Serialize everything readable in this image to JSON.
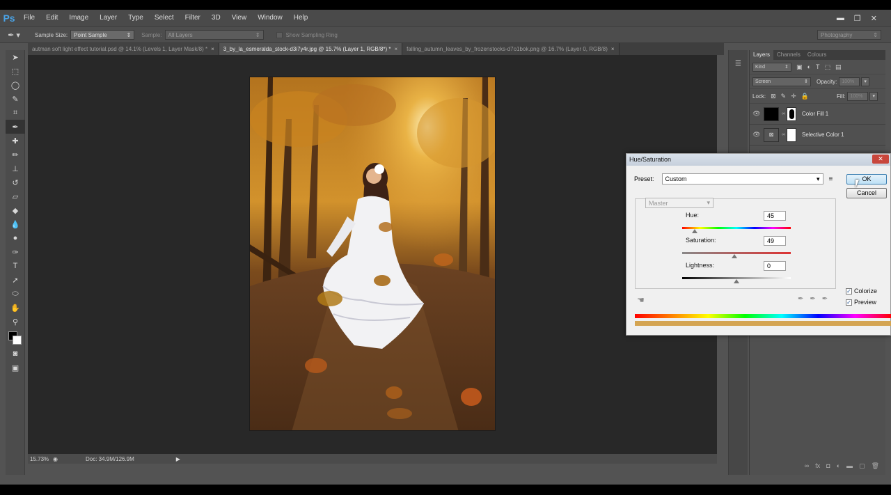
{
  "app": {
    "logo": "Ps"
  },
  "menu": [
    "File",
    "Edit",
    "Image",
    "Layer",
    "Type",
    "Select",
    "Filter",
    "3D",
    "View",
    "Window",
    "Help"
  ],
  "options_bar": {
    "sample_size_label": "Sample Size:",
    "sample_size_value": "Point Sample",
    "sample_label": "Sample:",
    "sample_value": "All Layers",
    "show_ring_label": "Show Sampling Ring",
    "workspace": "Photography"
  },
  "tabs": [
    {
      "label": "autman soft light effect tutorial.psd @ 14.1% (Levels 1, Layer Mask/8) *",
      "active": false
    },
    {
      "label": "3_by_la_esmeralda_stock-d3i7y4r.jpg @ 15.7% (Layer 1, RGB/8*) *",
      "active": true
    },
    {
      "label": "falling_autumn_leaves_by_frozenstocks-d7o1bok.png @ 16.7% (Layer 0, RGB/8)",
      "active": false
    }
  ],
  "status": {
    "zoom": "15.73%",
    "doc": "Doc: 34.9M/126.9M"
  },
  "layers_panel": {
    "tabs": [
      "Layers",
      "Channels",
      "Colours"
    ],
    "filter": "Kind",
    "blend_mode": "Screen",
    "opacity_label": "Opacity:",
    "opacity_value": "100%",
    "lock_label": "Lock:",
    "fill_label": "Fill:",
    "fill_value": "100%",
    "layers": [
      {
        "name": "Color Fill 1"
      },
      {
        "name": "Selective Color 1"
      }
    ]
  },
  "dialog": {
    "title": "Hue/Saturation",
    "preset_label": "Preset:",
    "preset_value": "Custom",
    "ok": "OK",
    "cancel": "Cancel",
    "channel": "Master",
    "hue_label": "Hue:",
    "hue_value": "45",
    "saturation_label": "Saturation:",
    "saturation_value": "49",
    "lightness_label": "Lightness:",
    "lightness_value": "0",
    "colorize": "Colorize",
    "preview": "Preview",
    "colorize_checked": true,
    "preview_checked": true,
    "colorize_color": "#d4a452"
  }
}
